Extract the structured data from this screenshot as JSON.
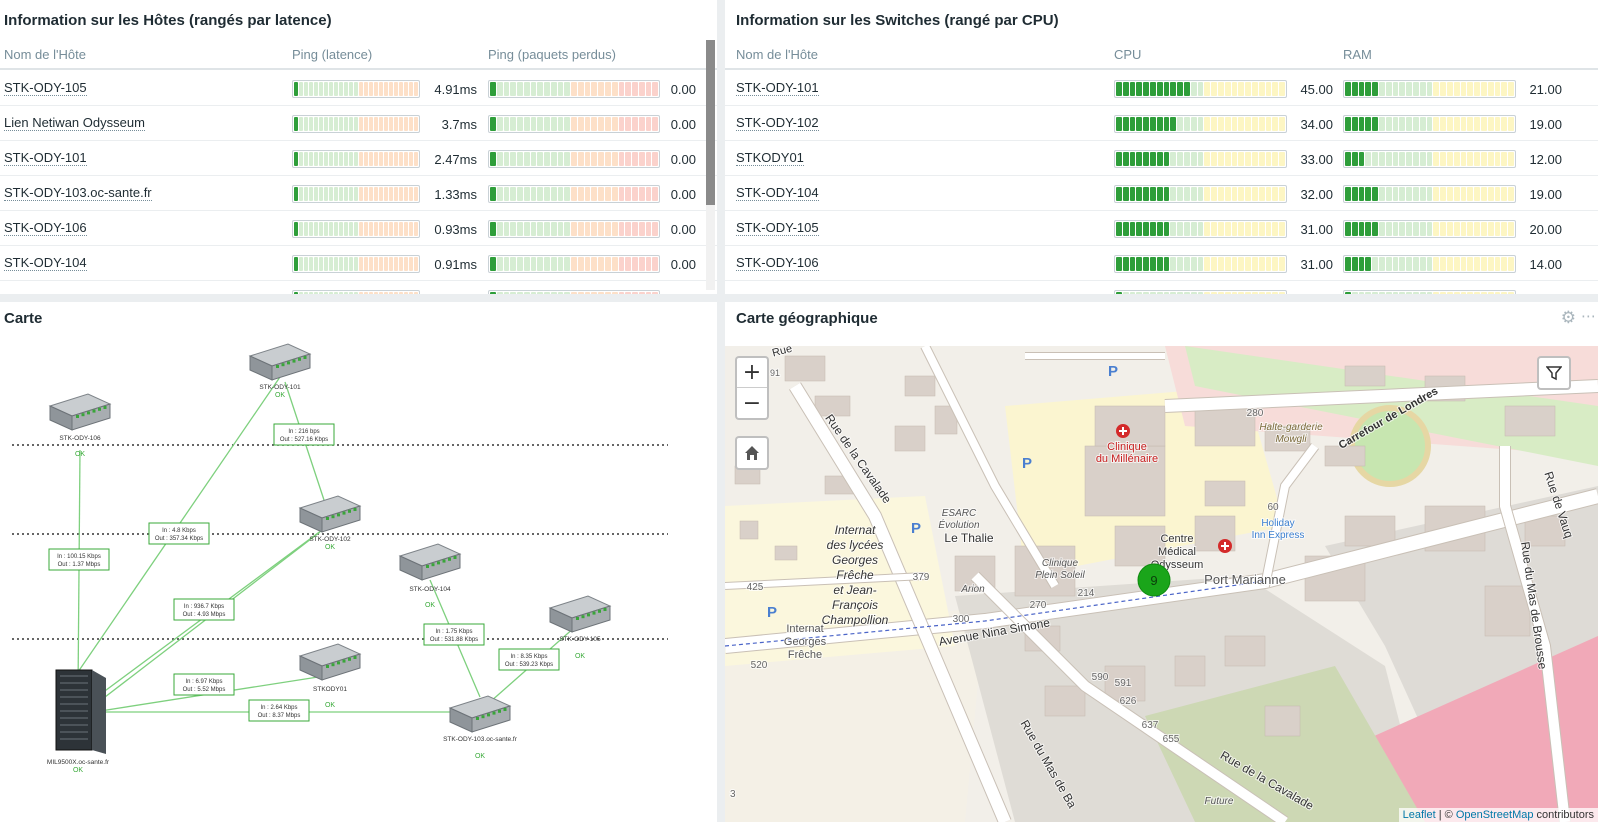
{
  "hosts_widget": {
    "title": "Information sur les Hôtes (rangés par latence)",
    "columns": [
      "Nom de l'Hôte",
      "Ping (latence)",
      "Ping (paquets perdus)"
    ],
    "rows": [
      {
        "name": "STK-ODY-105",
        "latency": "4.91ms",
        "latency_fill": 0.05,
        "loss": "0.00",
        "loss_fill": 0.0
      },
      {
        "name": "Lien Netiwan Odysseum",
        "latency": "3.7ms",
        "latency_fill": 0.05,
        "loss": "0.00",
        "loss_fill": 0.0
      },
      {
        "name": "STK-ODY-101",
        "latency": "2.47ms",
        "latency_fill": 0.05,
        "loss": "0.00",
        "loss_fill": 0.0
      },
      {
        "name": "STK-ODY-103.oc-sante.fr",
        "latency": "1.33ms",
        "latency_fill": 0.05,
        "loss": "0.00",
        "loss_fill": 0.0
      },
      {
        "name": "STK-ODY-106",
        "latency": "0.93ms",
        "latency_fill": 0.05,
        "loss": "0.00",
        "loss_fill": 0.0
      },
      {
        "name": "STK-ODY-104",
        "latency": "0.91ms",
        "latency_fill": 0.05,
        "loss": "0.00",
        "loss_fill": 0.0
      }
    ]
  },
  "switches_widget": {
    "title": "Information sur les Switches (rangé par CPU)",
    "columns": [
      "Nom de l'Hôte",
      "CPU",
      "RAM"
    ],
    "rows": [
      {
        "name": "STK-ODY-101",
        "cpu": "45.00",
        "cpu_fill": 0.45,
        "ram": "21.00",
        "ram_fill": 0.21
      },
      {
        "name": "STK-ODY-102",
        "cpu": "34.00",
        "cpu_fill": 0.34,
        "ram": "19.00",
        "ram_fill": 0.19
      },
      {
        "name": "STKODY01",
        "cpu": "33.00",
        "cpu_fill": 0.33,
        "ram": "12.00",
        "ram_fill": 0.12
      },
      {
        "name": "STK-ODY-104",
        "cpu": "32.00",
        "cpu_fill": 0.32,
        "ram": "19.00",
        "ram_fill": 0.19
      },
      {
        "name": "STK-ODY-105",
        "cpu": "31.00",
        "cpu_fill": 0.31,
        "ram": "20.00",
        "ram_fill": 0.2
      },
      {
        "name": "STK-ODY-106",
        "cpu": "31.00",
        "cpu_fill": 0.31,
        "ram": "14.00",
        "ram_fill": 0.14
      }
    ]
  },
  "network_map": {
    "title": "Carte",
    "nodes": [
      {
        "id": "n101",
        "label": "STK-ODY-101",
        "status": "OK"
      },
      {
        "id": "n106",
        "label": "STK-ODY-106",
        "status": "OK"
      },
      {
        "id": "n102",
        "label": "STK-ODY-102",
        "status": "OK"
      },
      {
        "id": "n104",
        "label": "STK-ODY-104",
        "status": "OK"
      },
      {
        "id": "n105",
        "label": "STK-ODY-105",
        "status": "OK"
      },
      {
        "id": "n01",
        "label": "STKODY01",
        "status": "OK"
      },
      {
        "id": "n103",
        "label": "STK-ODY-103.oc-sante.fr",
        "status": "OK"
      },
      {
        "id": "srv",
        "label": "MIL9500X.oc-sante.fr",
        "status": "OK"
      }
    ],
    "links": [
      {
        "in": "In : 216 bps",
        "out": "Out : 527.16 Kbps"
      },
      {
        "in": "In : 4.8 Kbps",
        "out": "Out : 357.34 Kbps"
      },
      {
        "in": "In : 100.15 Kbps",
        "out": "Out : 1.37 Mbps"
      },
      {
        "in": "In : 936.7 Kbps",
        "out": "Out : 4.93 Mbps"
      },
      {
        "in": "In : 1.75 Kbps",
        "out": "Out : 531.88 Kbps"
      },
      {
        "in": "In : 8.35 Kbps",
        "out": "Out : 539.23 Kbps"
      },
      {
        "in": "In : 6.97 Kbps",
        "out": "Out : 5.52 Mbps"
      },
      {
        "in": "In : 2.64 Kbps",
        "out": "Out : 8.37 Mbps"
      }
    ]
  },
  "geo_map": {
    "title": "Carte géographique",
    "zoom_in": "+",
    "zoom_out": "−",
    "cluster_count": "9",
    "labels": {
      "clinique": "Clinique",
      "millenaire": "du Millénaire",
      "halte": "Halte-garderie",
      "mowgli": "Mowgli",
      "carrefour": "Carrefour de Londres",
      "internat": "Internat",
      "lycees": "des lycées",
      "georges": "Georges",
      "freche": "Frêche",
      "et_jean": "et Jean-",
      "francois": "François",
      "champollion": "Champollion",
      "esarc": "ESARC",
      "evolution": "Évolution",
      "thalie": "Le Thalie",
      "centre": "Centre",
      "medical": "Médical",
      "odysseum": "Odysseum",
      "holiday": "Holiday",
      "inn": "Inn Express",
      "plein_soleil_1": "Clinique",
      "plein_soleil_2": "Plein Soleil",
      "arion": "Arion",
      "port_marianne": "Port Marianne",
      "nina": "Avenue Nina Simone",
      "cavalade": "Rue de la Cavalade",
      "cavalade2": "Rue de la Cavalade",
      "mas_brousse": "Rue du Mas de Brousse",
      "mas_ba": "Rue du Mas de Ba",
      "rue_vauq": "Rue de Vauq",
      "rue_top": "Rue",
      "internat2": "Internat",
      "georges2": "Georges",
      "freche2": "Frêche",
      "future": "Future",
      "n280": "280",
      "n60": "60",
      "n91": "91",
      "n425": "425",
      "n379": "379",
      "n300": "300",
      "n270": "270",
      "n214": "214",
      "n520": "520",
      "n590": "590",
      "n591": "591",
      "n626": "626",
      "n637": "637",
      "n655": "655",
      "n3": "3"
    },
    "attribution_leaflet": "Leaflet",
    "attribution_sep": " | © ",
    "attribution_osm": "OpenStreetMap",
    "attribution_tail": " contributors"
  },
  "colors": {
    "bar_green": "#2e9e3a",
    "bar_green_light": "#d6edd3",
    "bar_yellow": "#fdf6c3",
    "bar_orange": "#fde0c8",
    "bar_red": "#fbd2cc",
    "link_green": "#7ed07e",
    "status_green": "#3aaa3a"
  }
}
